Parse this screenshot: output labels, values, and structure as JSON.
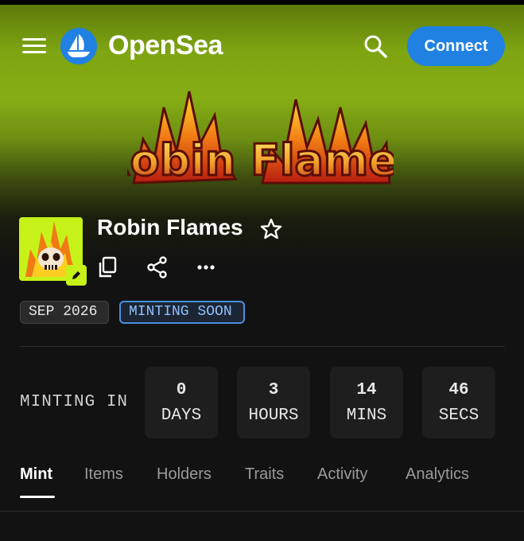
{
  "header": {
    "brand": "OpenSea",
    "connect_label": "Connect"
  },
  "collection": {
    "banner_text": "Robin Flames",
    "title": "Robin Flames",
    "date_chip": "SEP 2026",
    "status_chip": "MINTING SOON"
  },
  "countdown": {
    "label": "MINTING IN",
    "units": [
      {
        "value": "0",
        "label": "DAYS"
      },
      {
        "value": "3",
        "label": "HOURS"
      },
      {
        "value": "14",
        "label": "MINS"
      },
      {
        "value": "46",
        "label": "SECS"
      }
    ]
  },
  "tabs": [
    {
      "label": "Mint",
      "active": true
    },
    {
      "label": "Items",
      "active": false
    },
    {
      "label": "Holders",
      "active": false
    },
    {
      "label": "Traits",
      "active": false
    },
    {
      "label": "Activity",
      "active": false
    },
    {
      "label": "Analytics",
      "active": false
    }
  ],
  "colors": {
    "accent": "#2081e2",
    "background": "#121212",
    "banner_green": "#86ad14",
    "avatar_bg": "#c6f21a",
    "status_border": "#4a8fe0"
  },
  "icons": [
    "menu-icon",
    "opensea-logo-icon",
    "search-icon",
    "star-icon",
    "copy-icon",
    "share-icon",
    "more-icon",
    "pencil-icon"
  ]
}
